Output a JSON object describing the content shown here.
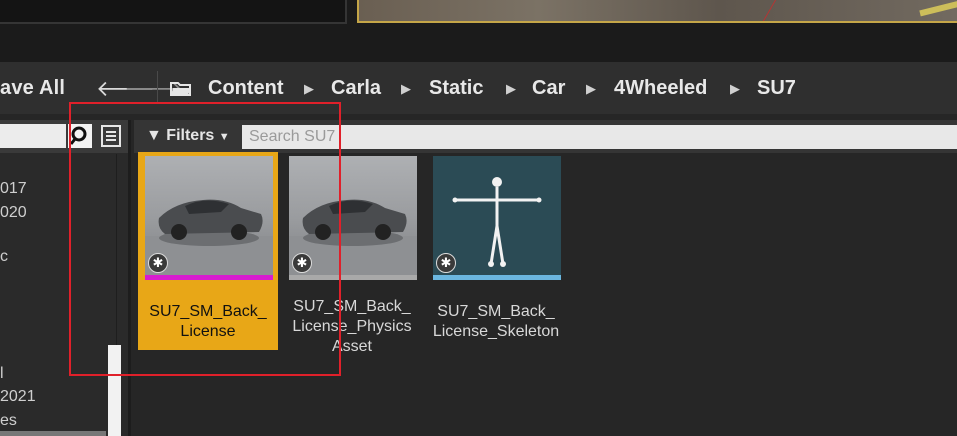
{
  "toolbar": {
    "save_all_label": "ave All",
    "breadcrumb": [
      "Content",
      "Carla",
      "Static",
      "Car",
      "4Wheeled",
      "SU7"
    ]
  },
  "sources": {
    "tree_items": [
      "017",
      "020",
      "c",
      "l",
      "2021",
      "es"
    ]
  },
  "assets": {
    "filters_label": "Filters",
    "search_placeholder": "Search SU7",
    "items": [
      {
        "label_lines": [
          "SU7_SM_Back_",
          "License"
        ],
        "strip_color": "#d81ccf",
        "selected": true
      },
      {
        "label_lines": [
          "SU7_SM_Back_",
          "License_Physics",
          "Asset"
        ],
        "strip_color": "#a9a9a9",
        "selected": false
      },
      {
        "label_lines": [
          "SU7_SM_Back_",
          "License_Skeleton"
        ],
        "strip_color": "#6bb7e0",
        "selected": false
      }
    ]
  },
  "colors": {
    "selection": "#e8a717",
    "highlight_box": "#e0202a"
  }
}
